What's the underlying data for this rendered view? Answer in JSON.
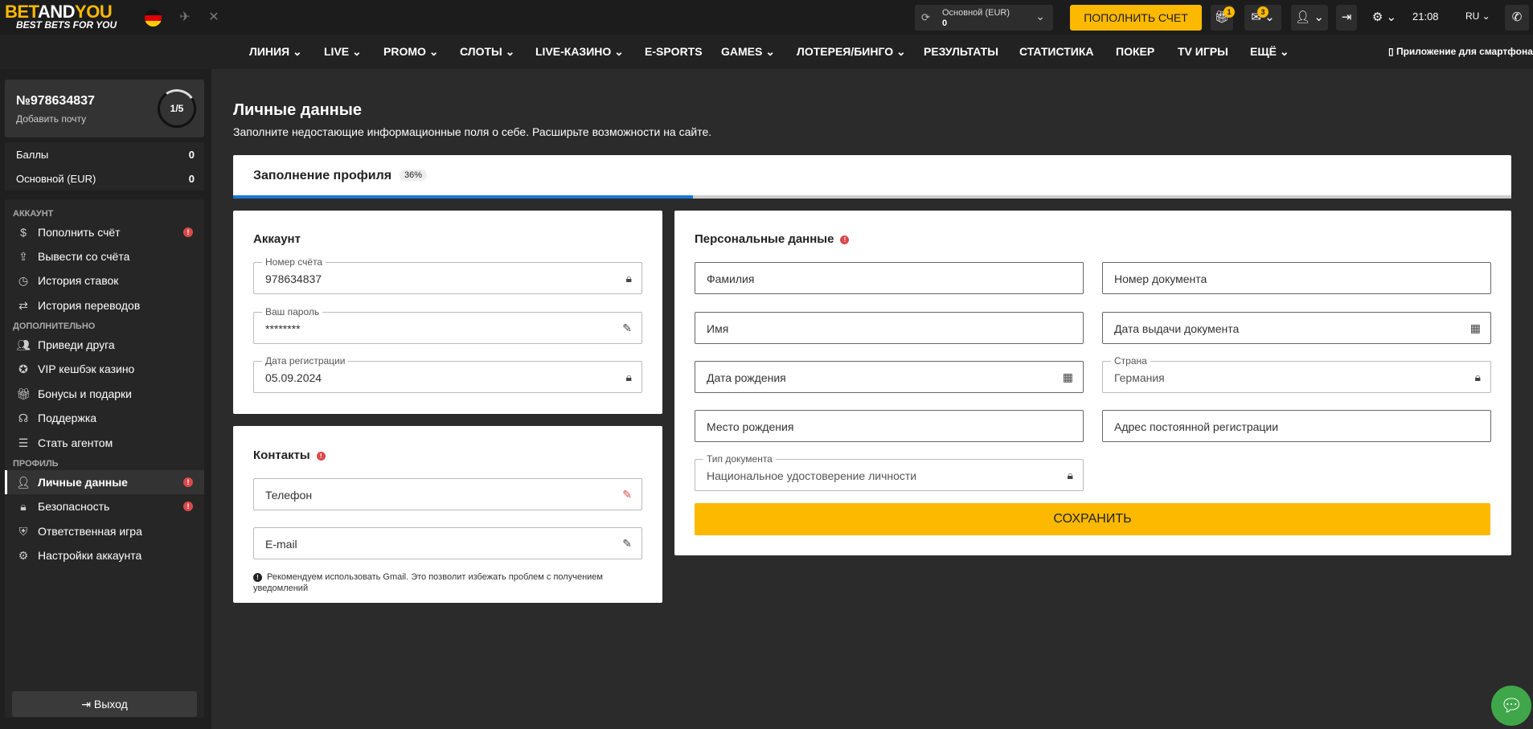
{
  "brand": {
    "name_a": "BET",
    "name_b": "AND",
    "name_c": "YOU",
    "tagline": "BEST BETS FOR YOU"
  },
  "header": {
    "balance_label": "Основной (EUR)",
    "balance_value": "0",
    "deposit_label": "ПОПОЛНИТЬ СЧЕТ",
    "gift_badge": "1",
    "mail_badge": "3",
    "time": "21:08",
    "lang": "RU"
  },
  "nav": {
    "items": [
      "ЛИНИЯ",
      "LIVE",
      "PROMO",
      "СЛОТЫ",
      "LIVE-КАЗИНО",
      "E-SPORTS",
      "GAMES",
      "ЛОТЕРЕЯ/БИНГО",
      "РЕЗУЛЬТАТЫ",
      "СТАТИСТИКА",
      "ПОКЕР",
      "TV ИГРЫ",
      "ЕЩЁ"
    ],
    "app_label": "Приложение для смартфона"
  },
  "sidebar": {
    "account_number": "№978634837",
    "add_email": "Добавить почту",
    "progress_text": "1/5",
    "progress_fraction": 0.2,
    "points_label": "Баллы",
    "points_value": "0",
    "main_label": "Основной (EUR)",
    "main_value": "0",
    "sections": {
      "account": "АККАУНТ",
      "extra": "ДОПОЛНИТЕЛЬНО",
      "profile": "ПРОФИЛЬ"
    },
    "items": {
      "deposit": "Пополнить счёт",
      "withdraw": "Вывести со счёта",
      "bet_history": "История ставок",
      "transfer_history": "История переводов",
      "invite": "Приведи друга",
      "vip": "VIP кешбэк казино",
      "bonuses": "Бонусы и подарки",
      "support": "Поддержка",
      "agent": "Стать агентом",
      "personal": "Личные данные",
      "security": "Безопасность",
      "responsible": "Ответственная игра",
      "settings": "Настройки аккаунта"
    },
    "logout": "Выход"
  },
  "page": {
    "title": "Личные данные",
    "subtitle": "Заполните недостающие информационные поля о себе. Расширьте возможности на сайте.",
    "progress_label": "Заполнение профиля",
    "progress_pct": "36%",
    "progress_value": 0.36
  },
  "account_card": {
    "title": "Аккаунт",
    "number_label": "Номер счёта",
    "number_value": "978634837",
    "password_label": "Ваш пароль",
    "password_value": "********",
    "reg_label": "Дата регистрации",
    "reg_value": "05.09.2024"
  },
  "contacts_card": {
    "title": "Контакты",
    "phone": "Телефон",
    "email": "E-mail",
    "note": "Рекомендуем использовать Gmail. Это позволит избежать проблем с получением уведомлений"
  },
  "personal_card": {
    "title": "Персональные данные",
    "surname": "Фамилия",
    "doc_number": "Номер документа",
    "name": "Имя",
    "doc_date": "Дата выдачи документа",
    "birth_date": "Дата рождения",
    "country_label": "Страна",
    "country_value": "Германия",
    "birth_place": "Место рождения",
    "address": "Адрес постоянной регистрации",
    "doc_type_label": "Тип документа",
    "doc_type_value": "Национальное удостоверение личности",
    "save": "СОХРАНИТЬ"
  },
  "colors": {
    "accent": "#fcb900",
    "progress": "#1877d6",
    "warn": "#d84a4a",
    "chat": "#3fa74a"
  }
}
